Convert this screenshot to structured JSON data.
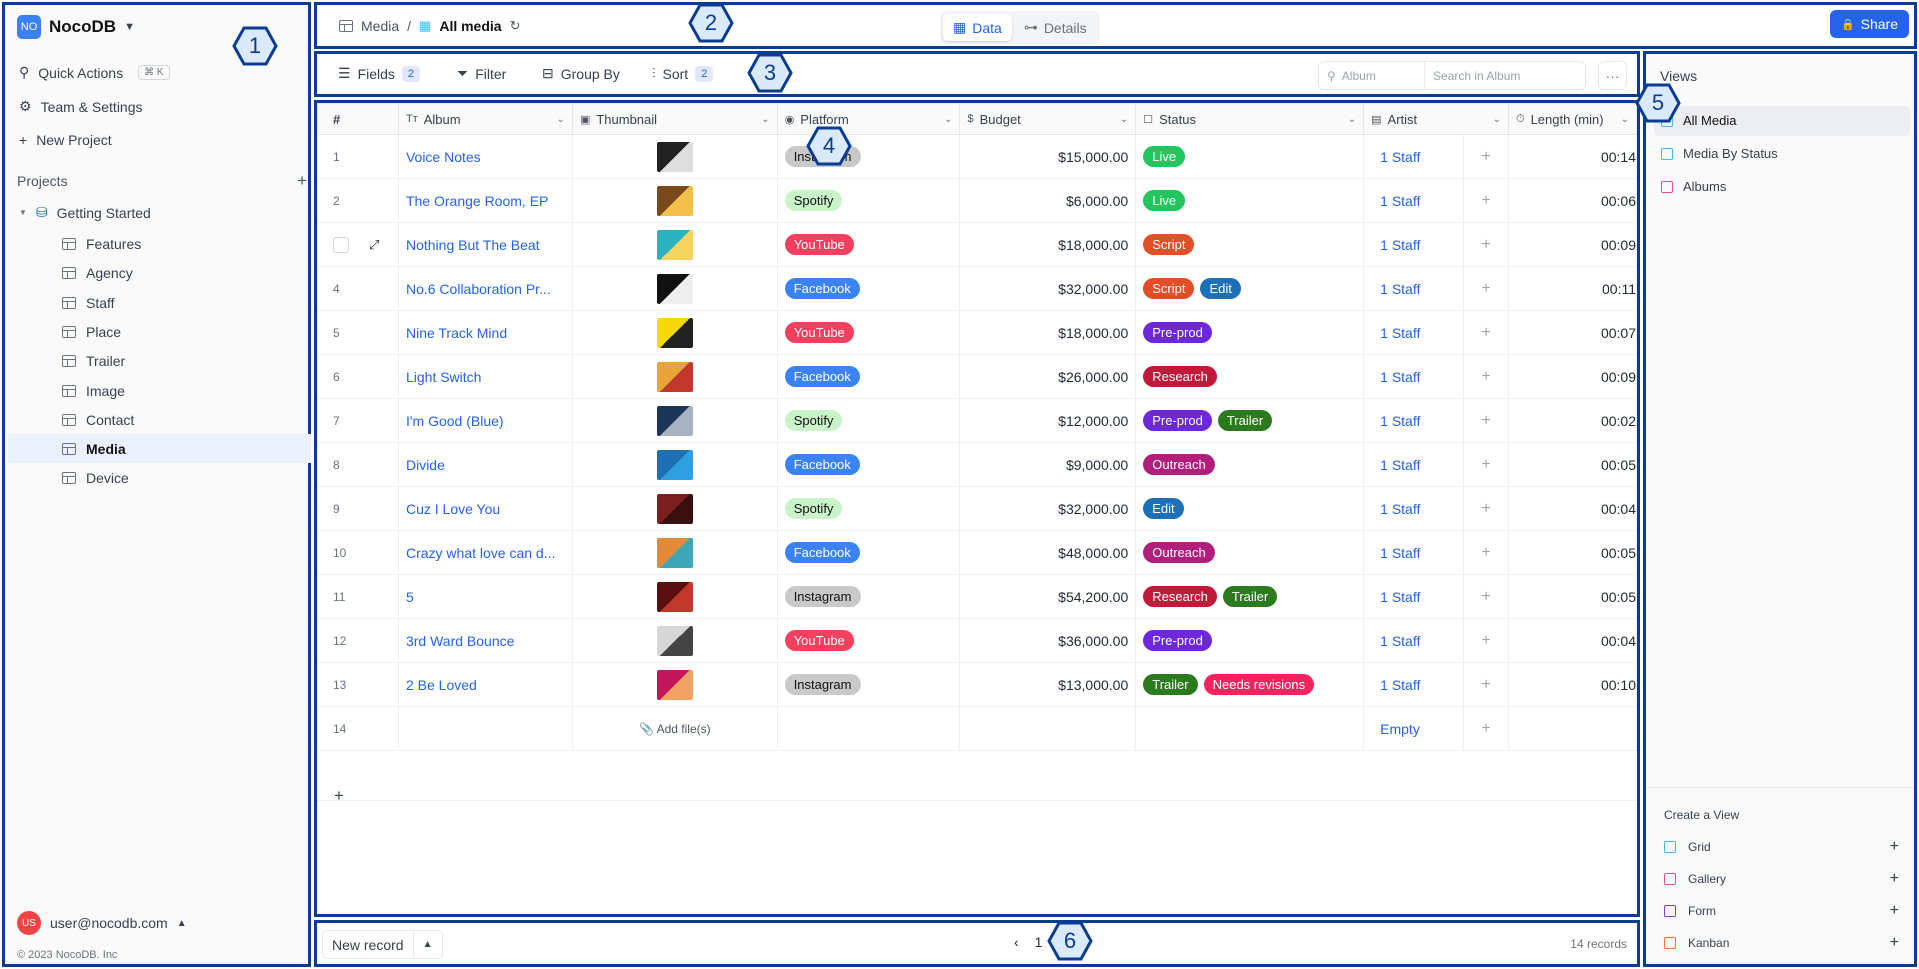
{
  "sidebar": {
    "workspace": "NocoDB",
    "logo": "NO",
    "quick_actions": "Quick Actions",
    "shortcut": "⌘ K",
    "team_settings": "Team & Settings",
    "new_project": "New Project",
    "projects_label": "Projects",
    "project": "Getting Started",
    "tables": [
      "Features",
      "Agency",
      "Staff",
      "Place",
      "Trailer",
      "Image",
      "Contact",
      "Media",
      "Device"
    ],
    "active_table": "Media",
    "user_initials": "US",
    "user": "user@nocodb.com",
    "copyright": "© 2023 NocoDB. Inc"
  },
  "topbar": {
    "table": "Media",
    "separator": "/",
    "view": "All media",
    "tab_data": "Data",
    "tab_details": "Details",
    "share": "Share"
  },
  "toolbar": {
    "fields": "Fields",
    "fields_count": "2",
    "filter": "Filter",
    "group_by": "Group By",
    "sort": "Sort",
    "sort_count": "2",
    "search_field": "Album",
    "search_placeholder": "Search in Album",
    "more": "···"
  },
  "grid": {
    "columns": [
      "#",
      "Album",
      "Thumbnail",
      "Platform",
      "Budget",
      "Status",
      "Artist",
      "Length (min)"
    ],
    "rows": [
      {
        "n": "1",
        "album": "Voice Notes",
        "platform": "Instagram",
        "budget": "$15,000.00",
        "status": [
          "Live"
        ],
        "artist": "1 Staff",
        "length": "00:14"
      },
      {
        "n": "2",
        "album": "The Orange Room, EP",
        "platform": "Spotify",
        "budget": "$6,000.00",
        "status": [
          "Live"
        ],
        "artist": "1 Staff",
        "length": "00:06"
      },
      {
        "n": "",
        "album": "Nothing But The Beat",
        "platform": "YouTube",
        "budget": "$18,000.00",
        "status": [
          "Script"
        ],
        "artist": "1 Staff",
        "length": "00:09"
      },
      {
        "n": "4",
        "album": "No.6 Collaboration Pr...",
        "platform": "Facebook",
        "budget": "$32,000.00",
        "status": [
          "Script",
          "Edit"
        ],
        "artist": "1 Staff",
        "length": "00:11"
      },
      {
        "n": "5",
        "album": "Nine Track Mind",
        "platform": "YouTube",
        "budget": "$18,000.00",
        "status": [
          "Pre-prod"
        ],
        "artist": "1 Staff",
        "length": "00:07"
      },
      {
        "n": "6",
        "album": "Light Switch",
        "platform": "Facebook",
        "budget": "$26,000.00",
        "status": [
          "Research"
        ],
        "artist": "1 Staff",
        "length": "00:09"
      },
      {
        "n": "7",
        "album": "I'm Good (Blue)",
        "platform": "Spotify",
        "budget": "$12,000.00",
        "status": [
          "Pre-prod",
          "Trailer"
        ],
        "artist": "1 Staff",
        "length": "00:02"
      },
      {
        "n": "8",
        "album": "Divide",
        "platform": "Facebook",
        "budget": "$9,000.00",
        "status": [
          "Outreach"
        ],
        "artist": "1 Staff",
        "length": "00:05"
      },
      {
        "n": "9",
        "album": "Cuz I Love You",
        "platform": "Spotify",
        "budget": "$32,000.00",
        "status": [
          "Edit"
        ],
        "artist": "1 Staff",
        "length": "00:04"
      },
      {
        "n": "10",
        "album": "Crazy what love can d...",
        "platform": "Facebook",
        "budget": "$48,000.00",
        "status": [
          "Outreach"
        ],
        "artist": "1 Staff",
        "length": "00:05"
      },
      {
        "n": "11",
        "album": "5",
        "platform": "Instagram",
        "budget": "$54,200.00",
        "status": [
          "Research",
          "Trailer"
        ],
        "artist": "1 Staff",
        "length": "00:05"
      },
      {
        "n": "12",
        "album": "3rd Ward Bounce",
        "platform": "YouTube",
        "budget": "$36,000.00",
        "status": [
          "Pre-prod"
        ],
        "artist": "1 Staff",
        "length": "00:04"
      },
      {
        "n": "13",
        "album": "2 Be Loved",
        "platform": "Instagram",
        "budget": "$13,000.00",
        "status": [
          "Trailer",
          "Needs revisions"
        ],
        "artist": "1 Staff",
        "length": "00:10"
      },
      {
        "n": "14",
        "album": "",
        "platform": "",
        "budget": "",
        "status": [],
        "artist": "Empty",
        "length": "",
        "add_file": "Add file(s)"
      }
    ],
    "add_row": "+"
  },
  "views": {
    "title": "Views",
    "items": [
      "All Media",
      "Media By Status",
      "Albums"
    ],
    "create_title": "Create a View",
    "create": [
      "Grid",
      "Gallery",
      "Form",
      "Kanban"
    ]
  },
  "footer": {
    "new_record": "New record",
    "page": "1",
    "records": "14 records"
  },
  "annotations": [
    "1",
    "2",
    "3",
    "4",
    "5",
    "6"
  ],
  "colors": {
    "frame": "#0a3c91",
    "accent": "#2563eb",
    "platform": {
      "Instagram": "#c9c9c9",
      "Spotify": "#c9f4c9",
      "YouTube": "#f43f5e",
      "Facebook": "#3b82f6"
    },
    "status": {
      "Live": "#22c55e",
      "Script": "#e04f28",
      "Edit": "#1d6fb8",
      "Pre-prod": "#6d28d9",
      "Research": "#c0193a",
      "Outreach": "#b11e7c",
      "Trailer": "#2b7a1e",
      "Needs revisions": "#f0255e"
    }
  }
}
